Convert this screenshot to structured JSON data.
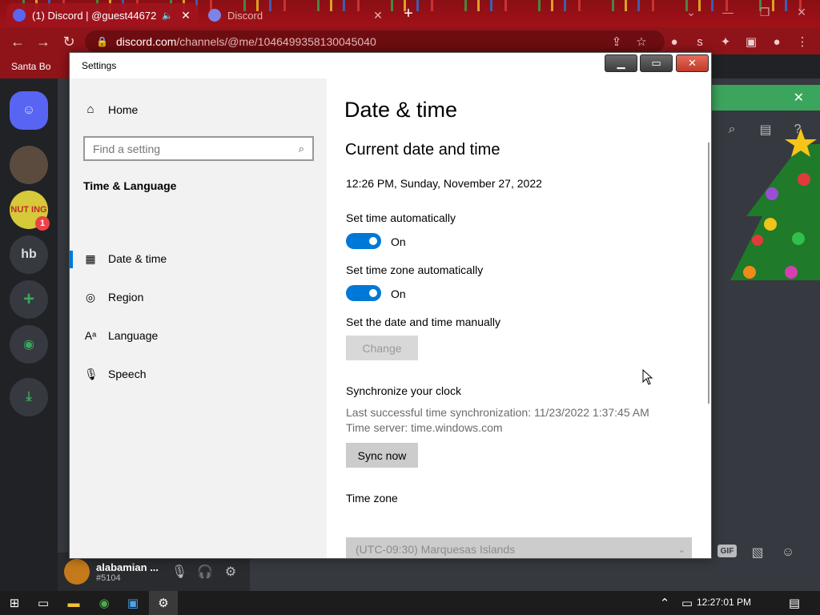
{
  "browser": {
    "tabs": [
      {
        "title": "(1) Discord | @guest44672",
        "active": true
      },
      {
        "title": "Discord",
        "active": false
      }
    ],
    "url_host": "discord.com",
    "url_path": "/channels/@me/1046499358130045040",
    "bookmark": "Santa Bo"
  },
  "discord": {
    "guilds": [
      "NUT ING",
      "hb"
    ],
    "badge": "1",
    "user_name": "alabamian ...",
    "user_tag": "#5104",
    "gif_label": "GIF"
  },
  "settings": {
    "window_title": "Settings",
    "nav": {
      "home": "Home",
      "search_placeholder": "Find a setting",
      "section": "Time & Language",
      "items": [
        {
          "label": "Date & time",
          "icon": "calendar-clock-icon",
          "active": true
        },
        {
          "label": "Region",
          "icon": "globe-icon",
          "active": false
        },
        {
          "label": "Language",
          "icon": "language-icon",
          "active": false
        },
        {
          "label": "Speech",
          "icon": "microphone-icon",
          "active": false
        }
      ]
    },
    "content": {
      "title": "Date & time",
      "subtitle": "Current date and time",
      "current_datetime": "12:26 PM, Sunday, November 27, 2022",
      "set_time_auto_label": "Set time automatically",
      "set_time_auto_state": "On",
      "set_tz_auto_label": "Set time zone automatically",
      "set_tz_auto_state": "On",
      "manual_label": "Set the date and time manually",
      "change_button": "Change",
      "sync_heading": "Synchronize your clock",
      "last_sync": "Last successful time synchronization: 11/23/2022 1:37:45 AM",
      "time_server": "Time server: time.windows.com",
      "sync_button": "Sync now",
      "timezone_label": "Time zone",
      "timezone_value": "(UTC-09:30) Marquesas Islands"
    }
  },
  "taskbar": {
    "clock": "12:27:01 PM"
  },
  "colors": {
    "accent": "#0078d7",
    "discord_blurple": "#5865f2",
    "chrome_theme": "#8f1419"
  }
}
